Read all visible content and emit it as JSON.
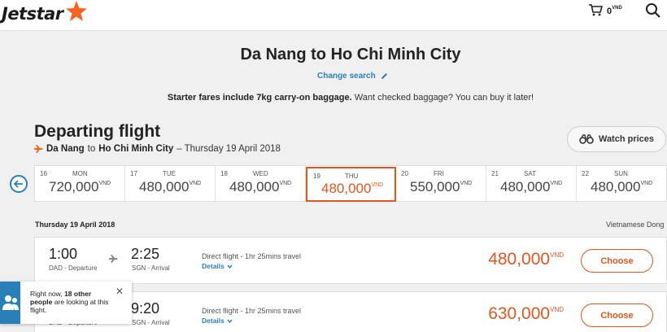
{
  "header": {
    "logo_text": "Jetstar",
    "cart_amount": "0",
    "cart_currency": "VND",
    "icons": [
      "cart-icon",
      "search-icon"
    ]
  },
  "search": {
    "route_title": "Da Nang to Ho Chi Minh City",
    "change_search": "Change search",
    "baggage_bold": "Starter fares include 7kg carry-on baggage.",
    "baggage_rest": "Want checked baggage? You can buy it later!"
  },
  "departing": {
    "title": "Departing flight",
    "origin": "Da Nang",
    "to": "to",
    "destination": "Ho Chi Minh City",
    "date_suffix": "– Thursday 19 April 2018",
    "watch_prices": "Watch prices"
  },
  "date_strip": {
    "days": [
      {
        "num": "16",
        "name": "MON",
        "price": "720,000",
        "currency": "VND",
        "selected": false
      },
      {
        "num": "17",
        "name": "TUE",
        "price": "480,000",
        "currency": "VND",
        "selected": false
      },
      {
        "num": "18",
        "name": "WED",
        "price": "480,000",
        "currency": "VND",
        "selected": false
      },
      {
        "num": "19",
        "name": "THU",
        "price": "480,000",
        "currency": "VND",
        "selected": true
      },
      {
        "num": "20",
        "name": "FRI",
        "price": "550,000",
        "currency": "VND",
        "selected": false
      },
      {
        "num": "21",
        "name": "SAT",
        "price": "480,000",
        "currency": "VND",
        "selected": false
      },
      {
        "num": "22",
        "name": "SUN",
        "price": "480,000",
        "currency": "VND",
        "selected": false
      }
    ]
  },
  "results": {
    "date_label": "Thursday 19 April 2018",
    "currency_label": "Vietnamese Dong",
    "flights": [
      {
        "dep_time": "1:00",
        "dep_code": "DAD - Departure",
        "arr_time": "2:25",
        "arr_code": "SGN - Arrival",
        "desc": "Direct flight - 1hr 25mins travel",
        "details": "Details",
        "price": "480,000",
        "currency": "VND",
        "choose": "Choose"
      },
      {
        "dep_time": "",
        "dep_code": "DAD - Departure",
        "arr_time": "9:20",
        "arr_code": "SGN - Arrival",
        "desc": "Direct flight - 1hr 25mins travel",
        "details": "Details",
        "price": "630,000",
        "currency": "VND",
        "choose": "Choose"
      }
    ]
  },
  "toast": {
    "text_pre": "Right now,",
    "text_bold": "18 other people",
    "text_post": "are looking at this flight.",
    "close": "✕"
  },
  "colors": {
    "accent_orange": "#e0561f",
    "link_blue": "#2a7fb8"
  }
}
